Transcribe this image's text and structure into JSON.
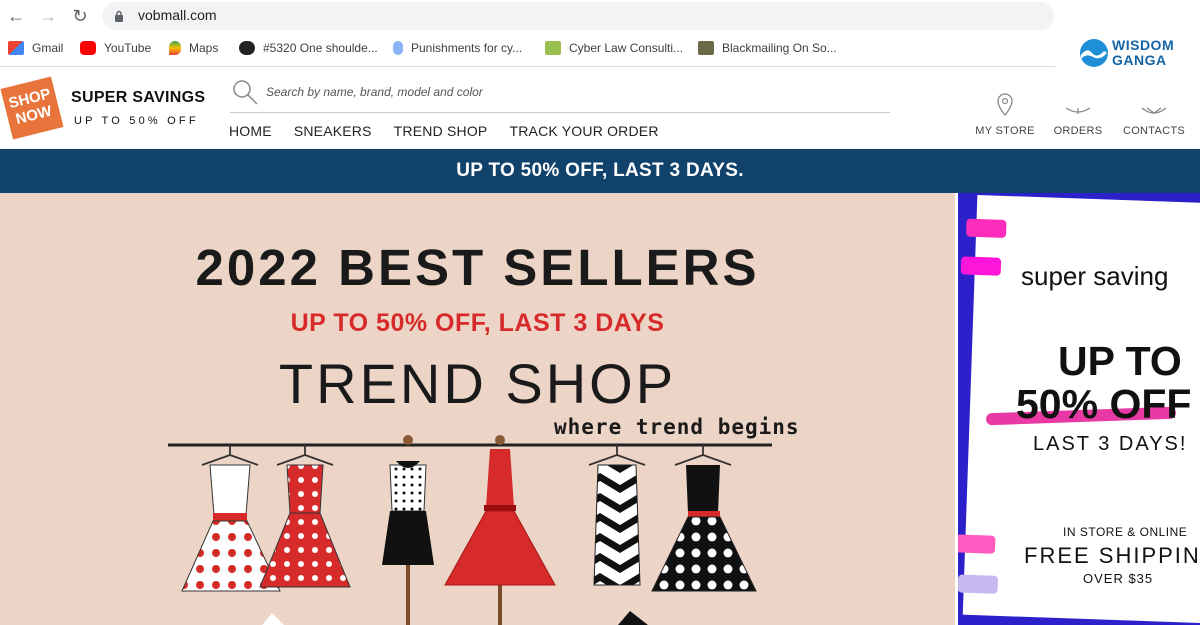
{
  "browser": {
    "url": "vobmall.com",
    "bookmarks": [
      {
        "label": "Gmail",
        "icon": "gmail-icon"
      },
      {
        "label": "YouTube",
        "icon": "youtube-icon"
      },
      {
        "label": "Maps",
        "icon": "maps-icon"
      },
      {
        "label": "#5320 One shoulde...",
        "icon": "site-icon"
      },
      {
        "label": "Punishments for cy...",
        "icon": "site-icon"
      },
      {
        "label": "Cyber Law Consulti...",
        "icon": "site-icon"
      },
      {
        "label": "Blackmailing On So...",
        "icon": "site-icon"
      }
    ]
  },
  "watermark": {
    "line1": "WISDOM",
    "line2": "GANGA"
  },
  "header": {
    "badge_line1": "SHOP",
    "badge_line2": "NOW",
    "brand_title": "SUPER SAVINGS",
    "brand_sub": "UP TO 50% OFF",
    "search_placeholder": "Search by name, brand, model and color",
    "nav": [
      "HOME",
      "SNEAKERS",
      "TREND SHOP",
      "TRACK YOUR ORDER"
    ],
    "utility": {
      "store": "MY STORE",
      "orders": "ORDERS",
      "contacts": "CONTACTS"
    }
  },
  "promo_bar": "UP TO 50% OFF, LAST 3 DAYS.",
  "hero": {
    "title": "2022 BEST SELLERS",
    "subtitle": "UP TO 50% OFF, LAST 3 DAYS",
    "shop_name": "TREND SHOP",
    "tagline": "where trend begins"
  },
  "side_ad": {
    "line1": "super saving",
    "line2": "UP TO",
    "line3": "50% OFF",
    "line4": "LAST 3 DAYS!",
    "line5": "IN STORE & ONLINE",
    "line6": "FREE SHIPPING",
    "line7": "OVER $35"
  },
  "colors": {
    "promo_bar": "#11426b",
    "hero_bg": "#ecd5c7",
    "accent_red": "#d72b2b",
    "badge_orange": "#e8743b",
    "side_frame": "#2b20c9",
    "highlight_pink": "#e6249a"
  }
}
